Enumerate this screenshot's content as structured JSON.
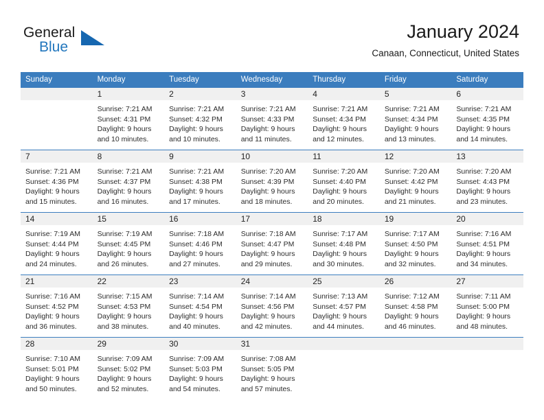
{
  "brand": {
    "line1": "General",
    "line2": "Blue",
    "icon": "triangle-logo",
    "colors": {
      "blue": "#2176bd",
      "triangle": "#1667b0",
      "dark": "#1a1a1a"
    }
  },
  "header": {
    "title": "January 2024",
    "location": "Canaan, Connecticut, United States"
  },
  "theme": {
    "header_row_bg": "#3b7dbe",
    "daynum_band_bg": "#f0f0f0",
    "cell_border": "#3b7dbe",
    "text": "#2b2b2b"
  },
  "weekday_headers": [
    "Sunday",
    "Monday",
    "Tuesday",
    "Wednesday",
    "Thursday",
    "Friday",
    "Saturday"
  ],
  "weeks": [
    [
      {
        "day": "",
        "lines": []
      },
      {
        "day": "1",
        "lines": [
          "Sunrise: 7:21 AM",
          "Sunset: 4:31 PM",
          "Daylight: 9 hours",
          "and 10 minutes."
        ]
      },
      {
        "day": "2",
        "lines": [
          "Sunrise: 7:21 AM",
          "Sunset: 4:32 PM",
          "Daylight: 9 hours",
          "and 10 minutes."
        ]
      },
      {
        "day": "3",
        "lines": [
          "Sunrise: 7:21 AM",
          "Sunset: 4:33 PM",
          "Daylight: 9 hours",
          "and 11 minutes."
        ]
      },
      {
        "day": "4",
        "lines": [
          "Sunrise: 7:21 AM",
          "Sunset: 4:34 PM",
          "Daylight: 9 hours",
          "and 12 minutes."
        ]
      },
      {
        "day": "5",
        "lines": [
          "Sunrise: 7:21 AM",
          "Sunset: 4:34 PM",
          "Daylight: 9 hours",
          "and 13 minutes."
        ]
      },
      {
        "day": "6",
        "lines": [
          "Sunrise: 7:21 AM",
          "Sunset: 4:35 PM",
          "Daylight: 9 hours",
          "and 14 minutes."
        ]
      }
    ],
    [
      {
        "day": "7",
        "lines": [
          "Sunrise: 7:21 AM",
          "Sunset: 4:36 PM",
          "Daylight: 9 hours",
          "and 15 minutes."
        ]
      },
      {
        "day": "8",
        "lines": [
          "Sunrise: 7:21 AM",
          "Sunset: 4:37 PM",
          "Daylight: 9 hours",
          "and 16 minutes."
        ]
      },
      {
        "day": "9",
        "lines": [
          "Sunrise: 7:21 AM",
          "Sunset: 4:38 PM",
          "Daylight: 9 hours",
          "and 17 minutes."
        ]
      },
      {
        "day": "10",
        "lines": [
          "Sunrise: 7:20 AM",
          "Sunset: 4:39 PM",
          "Daylight: 9 hours",
          "and 18 minutes."
        ]
      },
      {
        "day": "11",
        "lines": [
          "Sunrise: 7:20 AM",
          "Sunset: 4:40 PM",
          "Daylight: 9 hours",
          "and 20 minutes."
        ]
      },
      {
        "day": "12",
        "lines": [
          "Sunrise: 7:20 AM",
          "Sunset: 4:42 PM",
          "Daylight: 9 hours",
          "and 21 minutes."
        ]
      },
      {
        "day": "13",
        "lines": [
          "Sunrise: 7:20 AM",
          "Sunset: 4:43 PM",
          "Daylight: 9 hours",
          "and 23 minutes."
        ]
      }
    ],
    [
      {
        "day": "14",
        "lines": [
          "Sunrise: 7:19 AM",
          "Sunset: 4:44 PM",
          "Daylight: 9 hours",
          "and 24 minutes."
        ]
      },
      {
        "day": "15",
        "lines": [
          "Sunrise: 7:19 AM",
          "Sunset: 4:45 PM",
          "Daylight: 9 hours",
          "and 26 minutes."
        ]
      },
      {
        "day": "16",
        "lines": [
          "Sunrise: 7:18 AM",
          "Sunset: 4:46 PM",
          "Daylight: 9 hours",
          "and 27 minutes."
        ]
      },
      {
        "day": "17",
        "lines": [
          "Sunrise: 7:18 AM",
          "Sunset: 4:47 PM",
          "Daylight: 9 hours",
          "and 29 minutes."
        ]
      },
      {
        "day": "18",
        "lines": [
          "Sunrise: 7:17 AM",
          "Sunset: 4:48 PM",
          "Daylight: 9 hours",
          "and 30 minutes."
        ]
      },
      {
        "day": "19",
        "lines": [
          "Sunrise: 7:17 AM",
          "Sunset: 4:50 PM",
          "Daylight: 9 hours",
          "and 32 minutes."
        ]
      },
      {
        "day": "20",
        "lines": [
          "Sunrise: 7:16 AM",
          "Sunset: 4:51 PM",
          "Daylight: 9 hours",
          "and 34 minutes."
        ]
      }
    ],
    [
      {
        "day": "21",
        "lines": [
          "Sunrise: 7:16 AM",
          "Sunset: 4:52 PM",
          "Daylight: 9 hours",
          "and 36 minutes."
        ]
      },
      {
        "day": "22",
        "lines": [
          "Sunrise: 7:15 AM",
          "Sunset: 4:53 PM",
          "Daylight: 9 hours",
          "and 38 minutes."
        ]
      },
      {
        "day": "23",
        "lines": [
          "Sunrise: 7:14 AM",
          "Sunset: 4:54 PM",
          "Daylight: 9 hours",
          "and 40 minutes."
        ]
      },
      {
        "day": "24",
        "lines": [
          "Sunrise: 7:14 AM",
          "Sunset: 4:56 PM",
          "Daylight: 9 hours",
          "and 42 minutes."
        ]
      },
      {
        "day": "25",
        "lines": [
          "Sunrise: 7:13 AM",
          "Sunset: 4:57 PM",
          "Daylight: 9 hours",
          "and 44 minutes."
        ]
      },
      {
        "day": "26",
        "lines": [
          "Sunrise: 7:12 AM",
          "Sunset: 4:58 PM",
          "Daylight: 9 hours",
          "and 46 minutes."
        ]
      },
      {
        "day": "27",
        "lines": [
          "Sunrise: 7:11 AM",
          "Sunset: 5:00 PM",
          "Daylight: 9 hours",
          "and 48 minutes."
        ]
      }
    ],
    [
      {
        "day": "28",
        "lines": [
          "Sunrise: 7:10 AM",
          "Sunset: 5:01 PM",
          "Daylight: 9 hours",
          "and 50 minutes."
        ]
      },
      {
        "day": "29",
        "lines": [
          "Sunrise: 7:09 AM",
          "Sunset: 5:02 PM",
          "Daylight: 9 hours",
          "and 52 minutes."
        ]
      },
      {
        "day": "30",
        "lines": [
          "Sunrise: 7:09 AM",
          "Sunset: 5:03 PM",
          "Daylight: 9 hours",
          "and 54 minutes."
        ]
      },
      {
        "day": "31",
        "lines": [
          "Sunrise: 7:08 AM",
          "Sunset: 5:05 PM",
          "Daylight: 9 hours",
          "and 57 minutes."
        ]
      },
      {
        "day": "",
        "lines": []
      },
      {
        "day": "",
        "lines": []
      },
      {
        "day": "",
        "lines": []
      }
    ]
  ]
}
